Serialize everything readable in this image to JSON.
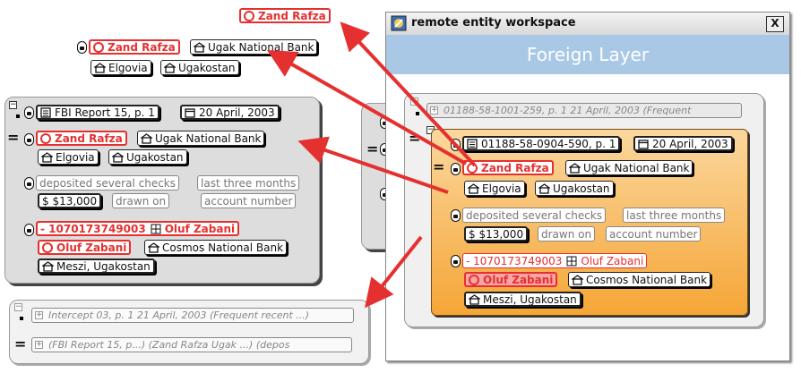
{
  "colors": {
    "entity_red": "#e53030",
    "layer_header": "#a9c8e6",
    "orange_top": "#fbd79e",
    "orange_bottom": "#f5a637"
  },
  "floating": {
    "top_node": "Zand Rafza",
    "row1": {
      "a": "Zand Rafza",
      "b": "Ugak National Bank"
    },
    "row2": {
      "a": "Elgovia",
      "b": "Ugakostan"
    }
  },
  "left_panel": {
    "report": "FBI Report 15, p. 1",
    "date": "20 April, 2003",
    "person": "Zand Rafza",
    "bank": "Ugak National Bank",
    "loc1": "Elgovia",
    "loc2": "Ugakostan",
    "action": "deposited several checks",
    "period": "last three months",
    "amount": "$ $13,000",
    "drawn": "drawn on",
    "account": "account number",
    "acct_no": "- 1070173749003",
    "acct_holder": "Oluf Zabani",
    "person2": "Oluf Zabani",
    "bank2": "Cosmos National Bank",
    "loc3": "Meszi, Ugakostan"
  },
  "bottom_panel": {
    "line1": "Intercept 03, p. 1  21 April, 2003  (Frequent recent ...)",
    "line2": "(FBI Report 15, p...)  (Zand Rafza Ugak ...)  (depos"
  },
  "window": {
    "title": "remote entity workspace",
    "close": "X",
    "layer": "Foreign Layer",
    "collapsed": "01188-58-1001-259, p. 1  21 April, 2003  (Frequent",
    "report": "01188-58-0904-590, p. 1",
    "date": "20 April, 2003",
    "person": "Zand Rafza",
    "bank": "Ugak National Bank",
    "loc1": "Elgovia",
    "loc2": "Ugakostan",
    "action": "deposited several checks",
    "period": "last three months",
    "amount": "$ $13,000",
    "drawn": "drawn on",
    "account": "account number",
    "acct_no": "- 1070173749003",
    "acct_holder": "Oluf Zabani",
    "person2": "Oluf Zabani",
    "bank2": "Cosmos National Bank",
    "loc3": "Meszi, Ugakostan"
  }
}
